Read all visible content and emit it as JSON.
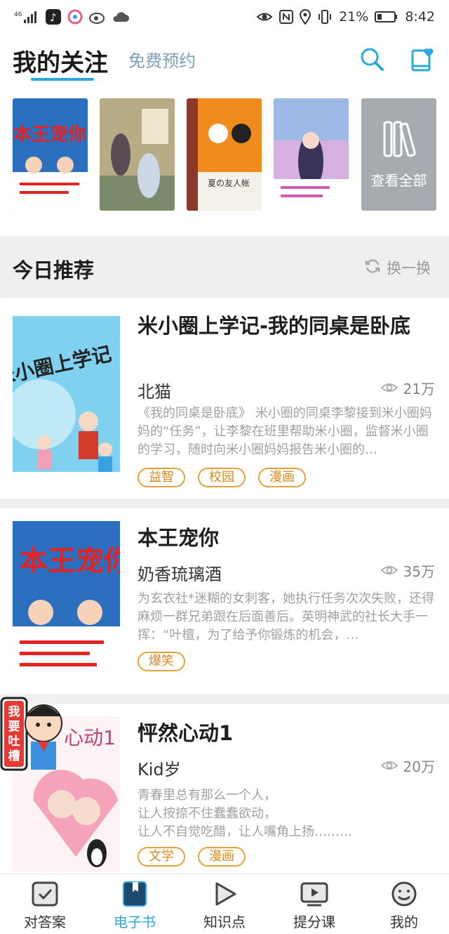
{
  "status_bar": {
    "signal": "46",
    "battery": "21%",
    "time": "8:42"
  },
  "header": {
    "title": "我的关注",
    "secondary_tab": "免费预约"
  },
  "shelf": {
    "covers": [
      {
        "title": "本王宠你"
      },
      {
        "title": ""
      },
      {
        "title": "夏の友人帐"
      },
      {
        "title": ""
      }
    ],
    "view_all": "查看全部"
  },
  "section": {
    "title": "今日推荐",
    "refresh_label": "换一换"
  },
  "books": [
    {
      "title": "米小圈上学记-我的同桌是卧底",
      "author": "北猫",
      "views": "21万",
      "desc": "《我的同桌是卧底》 米小圈的同桌李黎接到米小圈妈妈的“任务”，让李黎在班里帮助米小圈，监督米小圈的学习，随时向米小圈妈妈报告米小圈的…",
      "tags": [
        "益智",
        "校园",
        "漫画"
      ],
      "cover_text": "米小圈上学记"
    },
    {
      "title": "本王宠你",
      "author": "奶香琉璃酒",
      "views": "35万",
      "desc": "为玄衣社*迷糊的女刺客，她执行任务次次失败，还得麻烦一群兄弟跟在后面善后。英明神武的社长大手一挥：“叶檀，为了给予你锻炼的机会，…",
      "tags": [
        "爆笑"
      ],
      "cover_text": "本王宠你"
    },
    {
      "title": "怦然心动1",
      "author": "Kid岁",
      "views": "20万",
      "desc": "青春里总有那么一个人，\n让人按捺不住蠢蠢欲动，\n让人不自觉吃醋，让人嘴角上扬………",
      "tags": [
        "文学",
        "漫画"
      ],
      "cover_text": "心动1"
    }
  ],
  "float_badge": {
    "text": "我要吐槽"
  },
  "bottom_nav": [
    {
      "label": "对答案",
      "icon": "check-icon"
    },
    {
      "label": "电子书",
      "icon": "ebook-icon"
    },
    {
      "label": "知识点",
      "icon": "play-icon"
    },
    {
      "label": "提分课",
      "icon": "video-icon"
    },
    {
      "label": "我的",
      "icon": "smile-icon"
    }
  ],
  "colors": {
    "accent": "#2aa9e0",
    "tag": "#e6a23a",
    "section_bg": "#efefef"
  }
}
